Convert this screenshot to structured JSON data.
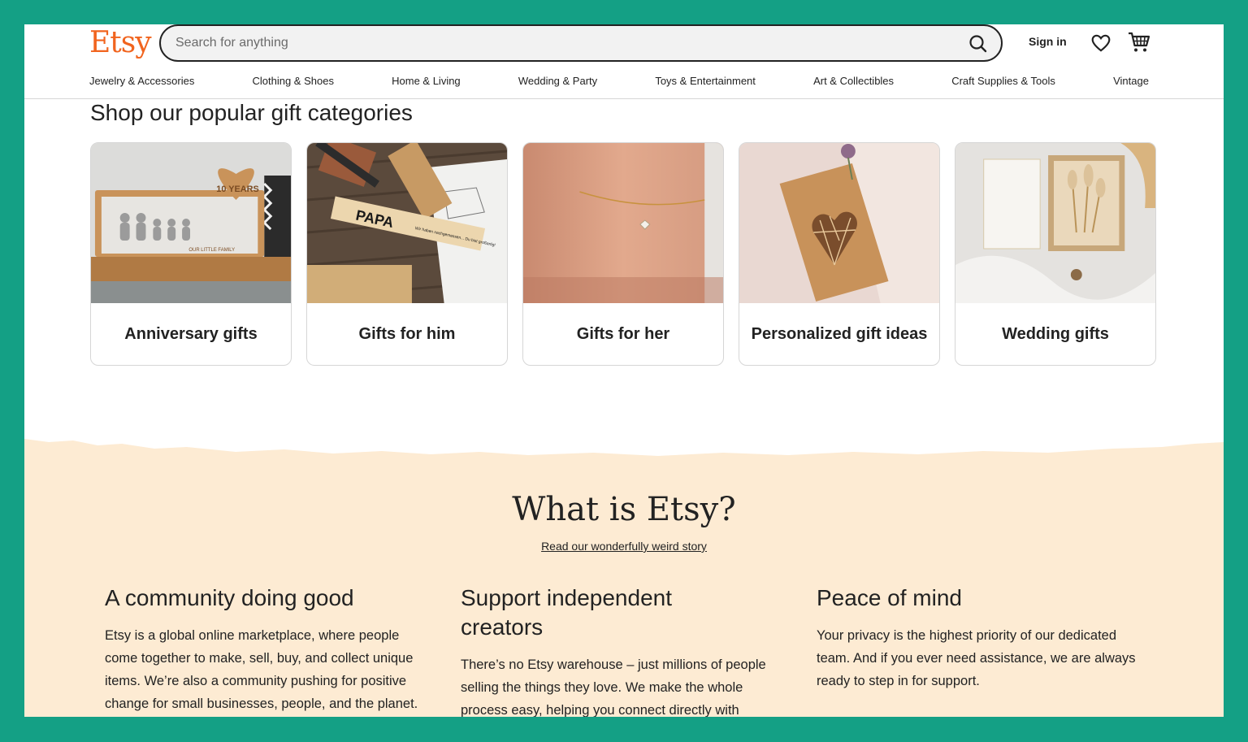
{
  "header": {
    "logo": "Etsy",
    "search_placeholder": "Search for anything",
    "signin_label": "Sign in"
  },
  "nav": [
    "Jewelry & Accessories",
    "Clothing & Shoes",
    "Home & Living",
    "Wedding & Party",
    "Toys & Entertainment",
    "Art & Collectibles",
    "Craft Supplies & Tools",
    "Vintage"
  ],
  "gifts": {
    "title": "Shop our popular gift categories",
    "cards": [
      {
        "label": "Anniversary gifts",
        "image_text": "10 YEARS",
        "image_subtext": "OUR LITTLE FAMILY"
      },
      {
        "label": "Gifts for him",
        "image_text": "PAPA",
        "image_subtext": "Wir haben nachgemessen... Du bist großartig!"
      },
      {
        "label": "Gifts for her"
      },
      {
        "label": "Personalized gift ideas"
      },
      {
        "label": "Wedding gifts"
      }
    ]
  },
  "about": {
    "title": "What is Etsy?",
    "link": "Read our wonderfully weird story",
    "columns": [
      {
        "heading": "A community doing good",
        "text": "Etsy is a global online marketplace, where people come together to make, sell, buy, and collect unique items. We’re also a community pushing for positive change for small businesses, people, and the planet. Here are some of the ways we’re making a positive"
      },
      {
        "heading": "Support independent creators",
        "text": "There’s no Etsy warehouse – just millions of people selling the things they love. We make the whole process easy, helping you connect directly with"
      },
      {
        "heading": "Peace of mind",
        "text": "Your privacy is the highest priority of our dedicated team. And if you ever need assistance, we are always ready to step in for support."
      }
    ]
  },
  "colors": {
    "brand_orange": "#f1641e",
    "frame_green": "#14a085",
    "about_background": "#fdebd3"
  },
  "icons": [
    "search-icon",
    "heart-icon",
    "cart-icon"
  ]
}
